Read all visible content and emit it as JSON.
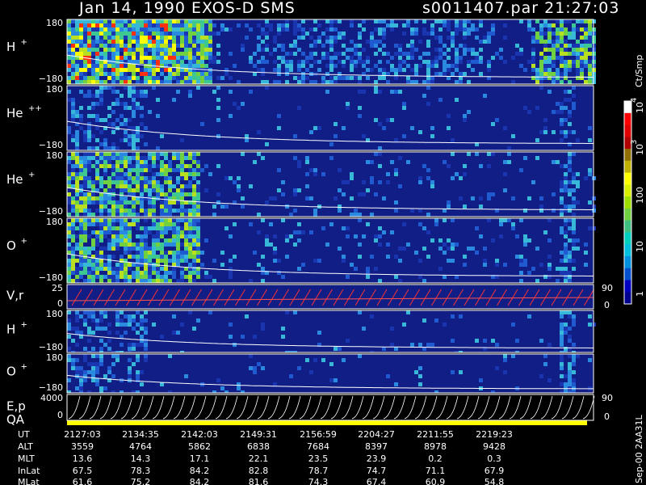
{
  "header": {
    "title": "Jan 14, 1990   EXOS-D SMS",
    "file": "s0011407.par  21:27:03"
  },
  "colorbar": {
    "unit": "Ct/Smp",
    "labels": [
      "1",
      "10",
      "100",
      "10",
      "10"
    ],
    "exponents": [
      "",
      "",
      "",
      "3",
      "4"
    ],
    "colors": [
      "#000090",
      "#0000c0",
      "#0050d0",
      "#0090e0",
      "#00c0e0",
      "#00d0c0",
      "#40c080",
      "#70d040",
      "#a0e000",
      "#d8f000",
      "#ffff00",
      "#c0b000",
      "#907000",
      "#b00000",
      "#e00000",
      "#ff0000",
      "#ffffff"
    ]
  },
  "panels": [
    {
      "id": "h-plus",
      "label": "H",
      "sup": "+",
      "ymax": "180",
      "ymin": "−180"
    },
    {
      "id": "he-plus-plus",
      "label": "He",
      "sup": "++",
      "ymax": "180",
      "ymin": "−180"
    },
    {
      "id": "he-plus",
      "label": "He",
      "sup": "+",
      "ymax": "180",
      "ymin": "−180"
    },
    {
      "id": "o-plus",
      "label": "O",
      "sup": "+",
      "ymax": "180",
      "ymin": "−180"
    },
    {
      "id": "v-r",
      "label": "V,r",
      "sup": "",
      "ymax": "25",
      "ymin": "0",
      "rmax": "90",
      "rmin": "0"
    },
    {
      "id": "h-plus-2",
      "label": "H",
      "sup": "+",
      "ymax": "180",
      "ymin": "−180"
    },
    {
      "id": "o-plus-2",
      "label": "O",
      "sup": "+",
      "ymax": "180",
      "ymin": "−180"
    },
    {
      "id": "e-p",
      "label": "E,p",
      "sup": "",
      "ymax": "4000",
      "ymin": "0",
      "rmax": "90",
      "rmin": "0"
    }
  ],
  "qa_label": "QA",
  "ephemeris": {
    "row_labels": [
      "UT",
      "ALT",
      "MLT",
      "InLat",
      "MLat"
    ],
    "columns": [
      [
        "2127:03",
        "3559",
        "13.6",
        "67.5",
        "61.6"
      ],
      [
        "2134:35",
        "4764",
        "14.3",
        "78.3",
        "75.2"
      ],
      [
        "2142:03",
        "5862",
        "17.1",
        "84.2",
        "84.2"
      ],
      [
        "2149:31",
        "6838",
        "22.1",
        "82.8",
        "81.6"
      ],
      [
        "2156:59",
        "7684",
        "23.5",
        "78.7",
        "74.3"
      ],
      [
        "2204:27",
        "8397",
        "23.9",
        "74.7",
        "67.4"
      ],
      [
        "2211:55",
        "8978",
        "0.2",
        "71.1",
        "60.9"
      ],
      [
        "2219:23",
        "9428",
        "0.3",
        "67.9",
        "54.8"
      ]
    ]
  },
  "footer_note": "Sep-00  2AA31L",
  "chart_data": {
    "type": "heatmap",
    "title": "Jan 14, 1990   EXOS-D SMS",
    "x_ticks": [
      "2127:03",
      "2134:35",
      "2142:03",
      "2149:31",
      "2156:59",
      "2204:27",
      "2211:55",
      "2219:23"
    ],
    "y_range_pitch": [
      -180,
      180
    ],
    "colorscale_unit": "Ct/Smp",
    "colorscale_range": [
      1,
      10000
    ],
    "colorscale_log": true,
    "series": [
      {
        "name": "H+",
        "range": [
          -180,
          180
        ]
      },
      {
        "name": "He++",
        "range": [
          -180,
          180
        ]
      },
      {
        "name": "He+",
        "range": [
          -180,
          180
        ]
      },
      {
        "name": "O+",
        "range": [
          -180,
          180
        ]
      },
      {
        "name": "V,r",
        "left_range": [
          0,
          25
        ],
        "right_range": [
          0,
          90
        ]
      },
      {
        "name": "H+",
        "range": [
          -180,
          180
        ]
      },
      {
        "name": "O+",
        "range": [
          -180,
          180
        ]
      },
      {
        "name": "E,p",
        "left_range": [
          0,
          4000
        ],
        "right_range": [
          0,
          90
        ]
      }
    ]
  }
}
